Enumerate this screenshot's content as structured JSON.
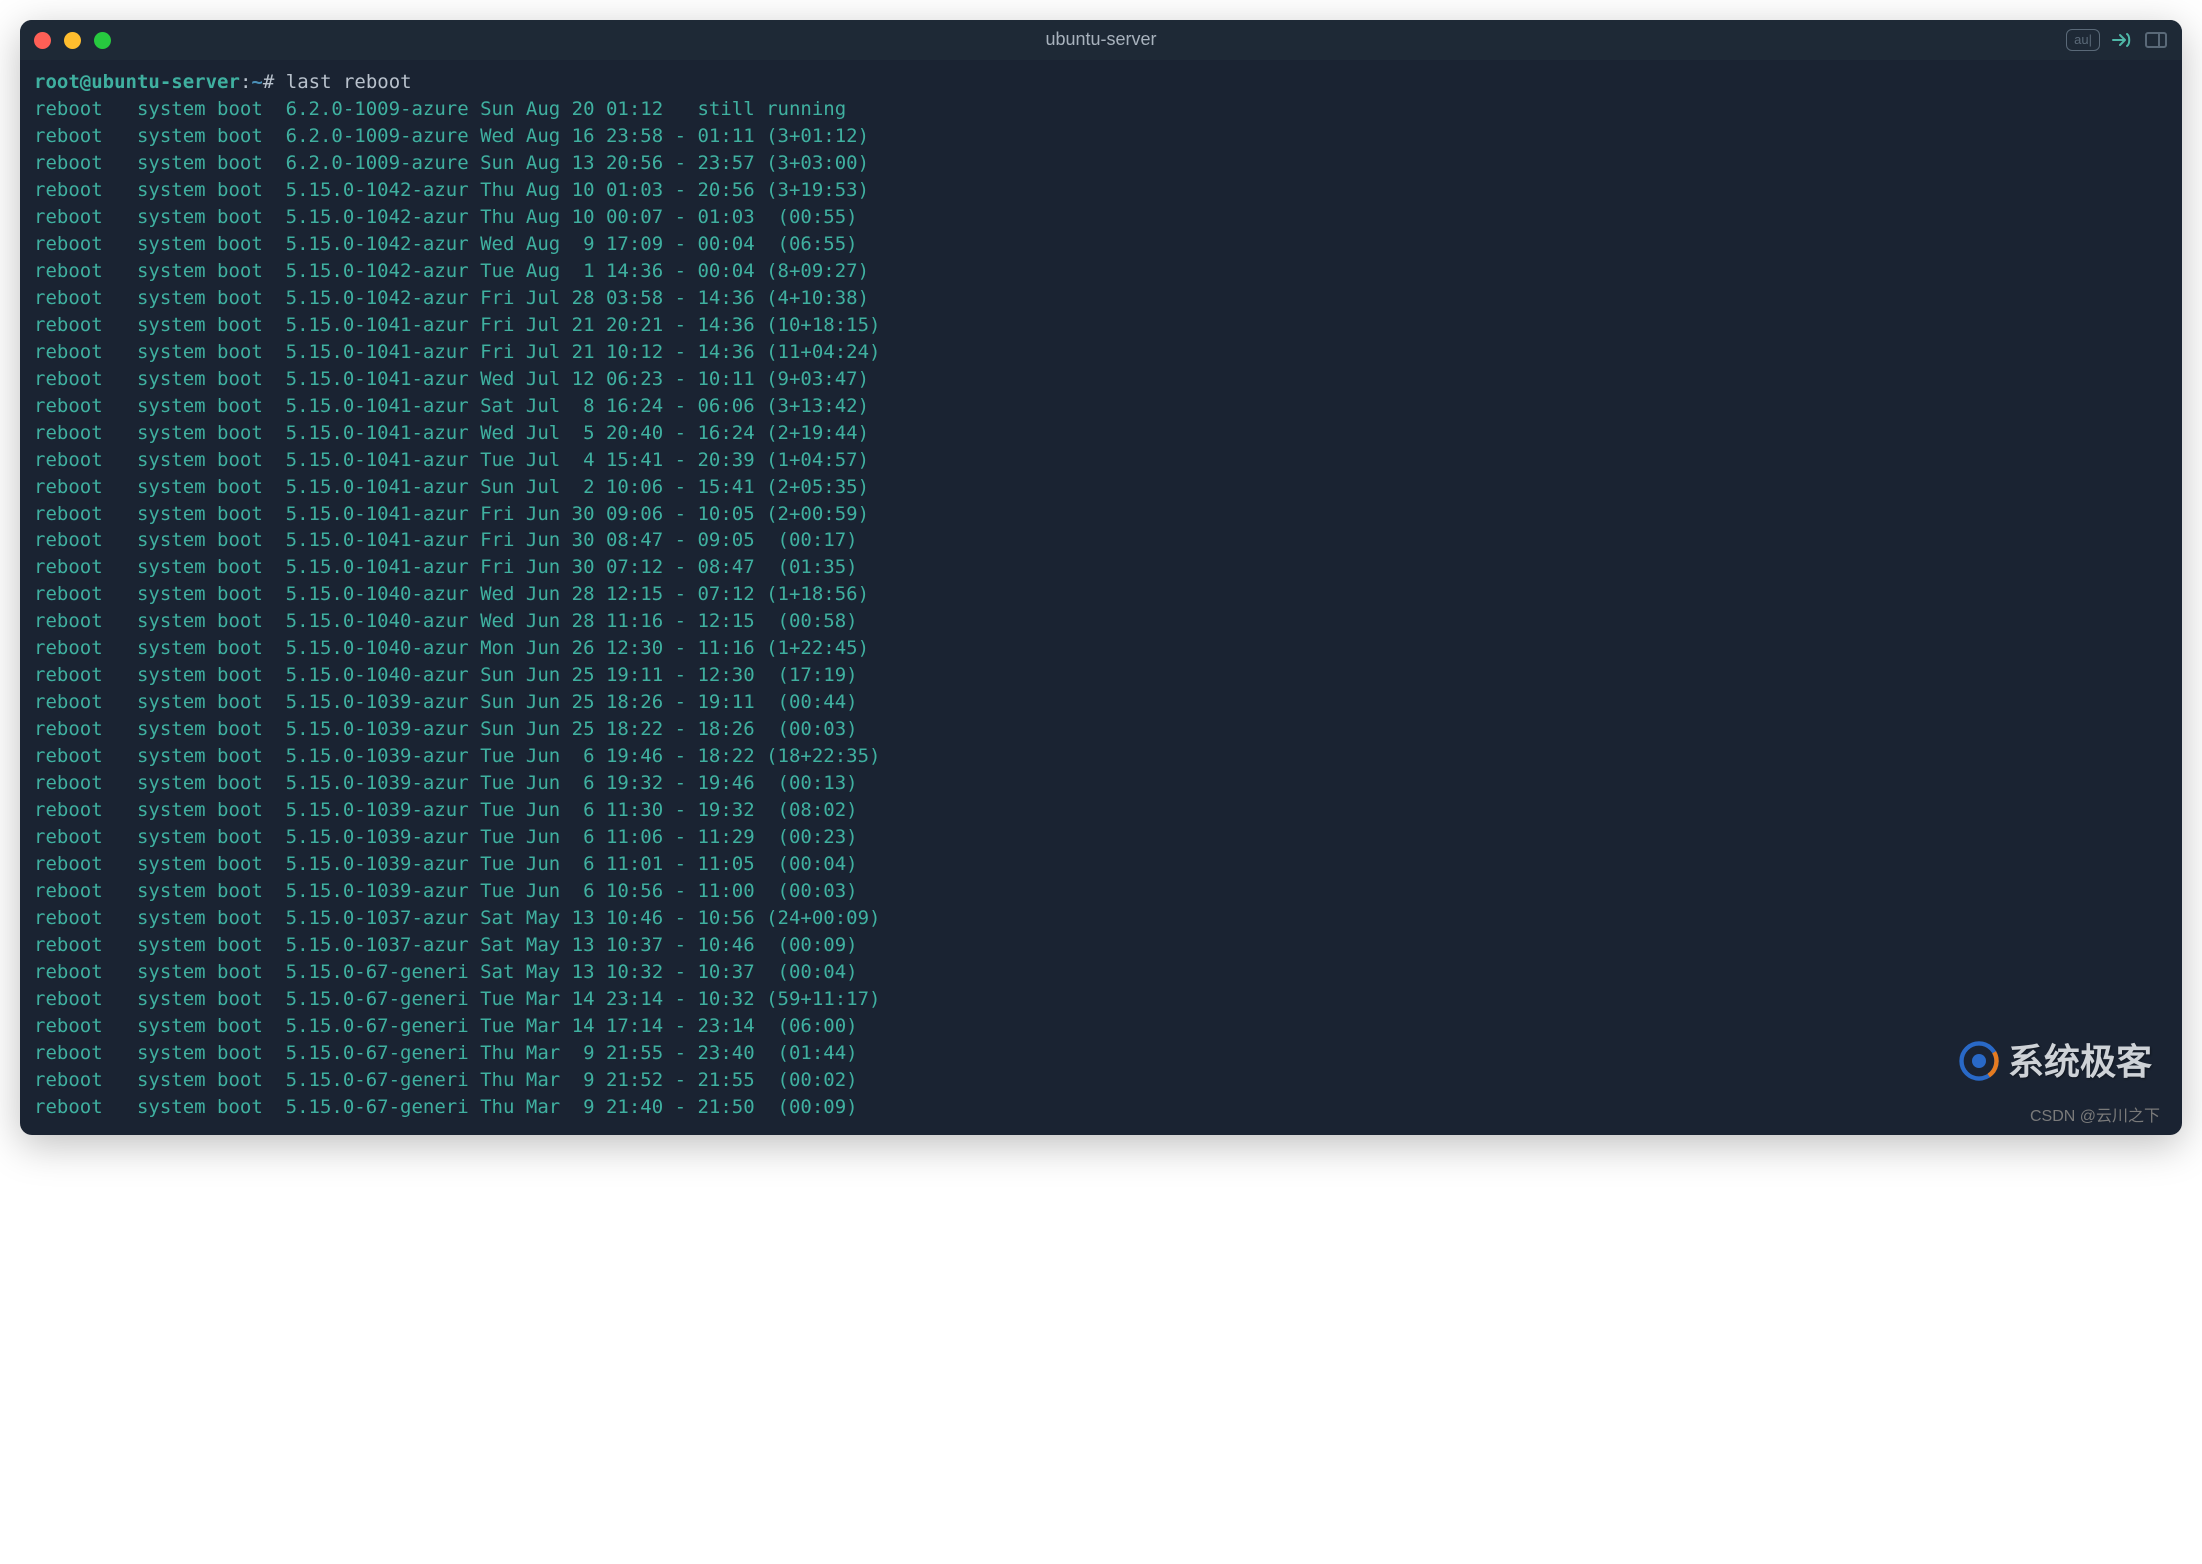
{
  "window": {
    "title": "ubuntu-server",
    "toolbar_pill": "au|"
  },
  "prompt": {
    "user": "root",
    "at": "@",
    "host": "ubuntu-server",
    "colon": ":",
    "path": "~",
    "hash": "#",
    "command": "last reboot"
  },
  "output": [
    "reboot   system boot  6.2.0-1009-azure Sun Aug 20 01:12   still running",
    "reboot   system boot  6.2.0-1009-azure Wed Aug 16 23:58 - 01:11 (3+01:12)",
    "reboot   system boot  6.2.0-1009-azure Sun Aug 13 20:56 - 23:57 (3+03:00)",
    "reboot   system boot  5.15.0-1042-azur Thu Aug 10 01:03 - 20:56 (3+19:53)",
    "reboot   system boot  5.15.0-1042-azur Thu Aug 10 00:07 - 01:03  (00:55)",
    "reboot   system boot  5.15.0-1042-azur Wed Aug  9 17:09 - 00:04  (06:55)",
    "reboot   system boot  5.15.0-1042-azur Tue Aug  1 14:36 - 00:04 (8+09:27)",
    "reboot   system boot  5.15.0-1042-azur Fri Jul 28 03:58 - 14:36 (4+10:38)",
    "reboot   system boot  5.15.0-1041-azur Fri Jul 21 20:21 - 14:36 (10+18:15)",
    "reboot   system boot  5.15.0-1041-azur Fri Jul 21 10:12 - 14:36 (11+04:24)",
    "reboot   system boot  5.15.0-1041-azur Wed Jul 12 06:23 - 10:11 (9+03:47)",
    "reboot   system boot  5.15.0-1041-azur Sat Jul  8 16:24 - 06:06 (3+13:42)",
    "reboot   system boot  5.15.0-1041-azur Wed Jul  5 20:40 - 16:24 (2+19:44)",
    "reboot   system boot  5.15.0-1041-azur Tue Jul  4 15:41 - 20:39 (1+04:57)",
    "reboot   system boot  5.15.0-1041-azur Sun Jul  2 10:06 - 15:41 (2+05:35)",
    "reboot   system boot  5.15.0-1041-azur Fri Jun 30 09:06 - 10:05 (2+00:59)",
    "reboot   system boot  5.15.0-1041-azur Fri Jun 30 08:47 - 09:05  (00:17)",
    "reboot   system boot  5.15.0-1041-azur Fri Jun 30 07:12 - 08:47  (01:35)",
    "reboot   system boot  5.15.0-1040-azur Wed Jun 28 12:15 - 07:12 (1+18:56)",
    "reboot   system boot  5.15.0-1040-azur Wed Jun 28 11:16 - 12:15  (00:58)",
    "reboot   system boot  5.15.0-1040-azur Mon Jun 26 12:30 - 11:16 (1+22:45)",
    "reboot   system boot  5.15.0-1040-azur Sun Jun 25 19:11 - 12:30  (17:19)",
    "reboot   system boot  5.15.0-1039-azur Sun Jun 25 18:26 - 19:11  (00:44)",
    "reboot   system boot  5.15.0-1039-azur Sun Jun 25 18:22 - 18:26  (00:03)",
    "reboot   system boot  5.15.0-1039-azur Tue Jun  6 19:46 - 18:22 (18+22:35)",
    "reboot   system boot  5.15.0-1039-azur Tue Jun  6 19:32 - 19:46  (00:13)",
    "reboot   system boot  5.15.0-1039-azur Tue Jun  6 11:30 - 19:32  (08:02)",
    "reboot   system boot  5.15.0-1039-azur Tue Jun  6 11:06 - 11:29  (00:23)",
    "reboot   system boot  5.15.0-1039-azur Tue Jun  6 11:01 - 11:05  (00:04)",
    "reboot   system boot  5.15.0-1039-azur Tue Jun  6 10:56 - 11:00  (00:03)",
    "reboot   system boot  5.15.0-1037-azur Sat May 13 10:46 - 10:56 (24+00:09)",
    "reboot   system boot  5.15.0-1037-azur Sat May 13 10:37 - 10:46  (00:09)",
    "reboot   system boot  5.15.0-67-generi Sat May 13 10:32 - 10:37  (00:04)",
    "reboot   system boot  5.15.0-67-generi Tue Mar 14 23:14 - 10:32 (59+11:17)",
    "reboot   system boot  5.15.0-67-generi Tue Mar 14 17:14 - 23:14  (06:00)",
    "reboot   system boot  5.15.0-67-generi Thu Mar  9 21:55 - 23:40  (01:44)",
    "reboot   system boot  5.15.0-67-generi Thu Mar  9 21:52 - 21:55  (00:02)",
    "reboot   system boot  5.15.0-67-generi Thu Mar  9 21:40 - 21:50  (00:09)"
  ],
  "watermark": {
    "brand": "系统极客",
    "csdn": "CSDN @云川之下"
  }
}
